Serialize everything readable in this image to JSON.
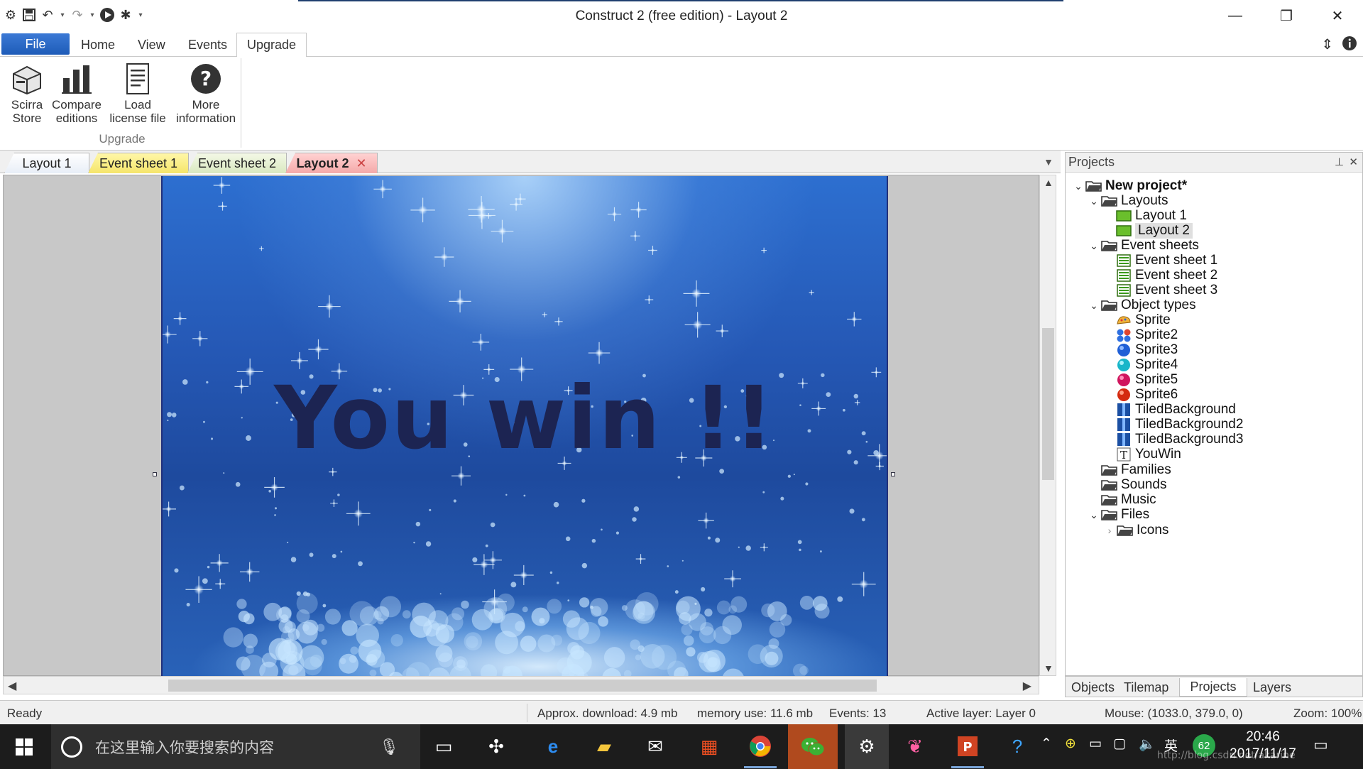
{
  "window": {
    "title": "Construct 2  (free edition) - Layout 2"
  },
  "ribbon": {
    "file_label": "File",
    "tabs": [
      "Home",
      "View",
      "Events",
      "Upgrade"
    ],
    "group_label": "Upgrade",
    "buttons": [
      {
        "line1": "Scirra",
        "line2": "Store"
      },
      {
        "line1": "Compare",
        "line2": "editions"
      },
      {
        "line1": "Load",
        "line2": "license file"
      },
      {
        "line1": "More",
        "line2": "information"
      }
    ]
  },
  "doc_tabs": [
    "Layout 1",
    "Event sheet 1",
    "Event sheet 2",
    "Layout 2"
  ],
  "canvas": {
    "text": "You win !!"
  },
  "projects_panel": {
    "title": "Projects",
    "tree": {
      "root": "New project*",
      "layouts_folder": "Layouts",
      "layouts": [
        "Layout 1",
        "Layout 2"
      ],
      "events_folder": "Event sheets",
      "events": [
        "Event sheet 1",
        "Event sheet 2",
        "Event sheet 3"
      ],
      "objects_folder": "Object types",
      "objects": [
        "Sprite",
        "Sprite2",
        "Sprite3",
        "Sprite4",
        "Sprite5",
        "Sprite6",
        "TiledBackground",
        "TiledBackground2",
        "TiledBackground3",
        "YouWin"
      ],
      "families": "Families",
      "sounds": "Sounds",
      "music": "Music",
      "files": "Files",
      "icons": "Icons"
    },
    "tabs": [
      "Objects",
      "Tilemap",
      "Projects",
      "Layers"
    ]
  },
  "status": {
    "ready": "Ready",
    "download": "Approx. download: 4.9 mb",
    "memory": "memory use: 11.6 mb",
    "events": "Events: 13",
    "layer": "Active layer: Layer 0",
    "mouse": "Mouse: (1033.0, 379.0, 0)",
    "zoom": "Zoom: 100%"
  },
  "taskbar": {
    "search_placeholder": "在这里输入你要搜索的内容",
    "ime": "英",
    "battery": "62",
    "time": "20:46",
    "date": "2017/11/17",
    "watermark": "http://blog.csdn.net/akarine"
  },
  "colors": {
    "file_tab": "#1e5bb8",
    "scene_blue": "#2558b5",
    "win_text": "#1c2452",
    "tab_event_sheet_1": "#f5e56a",
    "tab_layout_2": "#f4a9a9"
  }
}
